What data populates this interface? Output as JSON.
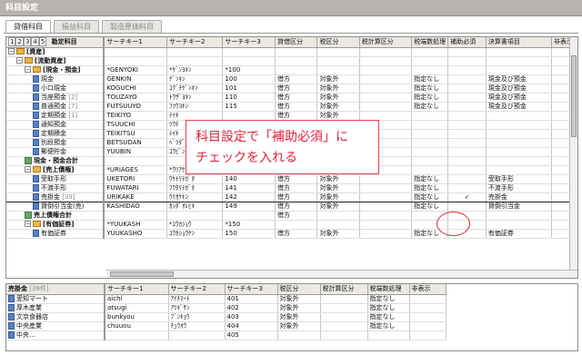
{
  "window": {
    "title": "科目設定"
  },
  "tabs": [
    {
      "label": "貸借科目"
    },
    {
      "label": "損益科目"
    },
    {
      "label": "製造原価科目"
    }
  ],
  "grid": {
    "levels": [
      "1",
      "2",
      "3",
      "4",
      "5"
    ],
    "columns": [
      "勘定科目",
      "サーチキー1",
      "サーチキー2",
      "サーチキー3",
      "貸借区分",
      "税区分",
      "税計算区分",
      "税端数処理",
      "補助必須",
      "決算書項目",
      "非表示"
    ],
    "rows": [
      {
        "name": "[資産]",
        "k1": "",
        "k2": "",
        "k3": "",
        "dr": "",
        "tax": "",
        "calc": "",
        "frac": "",
        "req": "",
        "fin": "",
        "hide": ""
      },
      {
        "name": "[流動資産]",
        "k1": "",
        "k2": "",
        "k3": "",
        "dr": "",
        "tax": "",
        "calc": "",
        "frac": "",
        "req": "",
        "fin": "",
        "hide": ""
      },
      {
        "name": "[現金・預金]",
        "k1": "*GENYOKI",
        "k2": "*ｹﾞﾝﾖｷﾝ",
        "k3": "*100",
        "dr": "",
        "tax": "",
        "calc": "",
        "frac": "",
        "req": "",
        "fin": "",
        "hide": ""
      },
      {
        "name": "現金",
        "k1": "GENKIN",
        "k2": "ｹﾞﾝｷﾝ",
        "k3": "100",
        "dr": "借方",
        "tax": "対象外",
        "calc": "",
        "frac": "指定なし",
        "req": "",
        "fin": "現金及び預金",
        "hide": ""
      },
      {
        "name": "小口現金",
        "k1": "KOGUCHI",
        "k2": "ｺｸﾞﾁｹﾞﾝｷﾝ",
        "k3": "101",
        "dr": "借方",
        "tax": "対象外",
        "calc": "",
        "frac": "指定なし",
        "req": "",
        "fin": "現金及び預金",
        "hide": ""
      },
      {
        "name": "当座預金",
        "count": "[2]",
        "k1": "TOUZAYO",
        "k2": "ﾄｳｻﾞﾖｷﾝ",
        "k3": "110",
        "dr": "借方",
        "tax": "対象外",
        "calc": "",
        "frac": "指定なし",
        "req": "",
        "fin": "現金及び預金",
        "hide": ""
      },
      {
        "name": "普通預金",
        "count": "[7]",
        "k1": "FUTSUUYO",
        "k2": "ﾌﾂｳﾖｷﾝ",
        "k3": "115",
        "dr": "借方",
        "tax": "対象外",
        "calc": "",
        "frac": "指定なし",
        "req": "",
        "fin": "現金及び預金",
        "hide": ""
      },
      {
        "name": "定期預金",
        "count": "[1]",
        "k1": "TEIKIYO",
        "k2": "ﾃｲｷ",
        "k3": "",
        "dr": "借方",
        "tax": "対象外",
        "calc": "",
        "frac": "",
        "req": "",
        "fin": "",
        "hide": ""
      },
      {
        "name": "通知預金",
        "k1": "TSUUCHI",
        "k2": "ﾂｳﾁ",
        "k3": "",
        "dr": "",
        "tax": "",
        "calc": "",
        "frac": "",
        "req": "",
        "fin": "",
        "hide": ""
      },
      {
        "name": "定期積金",
        "k1": "TEIKITSU",
        "k2": "ﾃｲｷ",
        "k3": "",
        "dr": "",
        "tax": "",
        "calc": "",
        "frac": "",
        "req": "",
        "fin": "",
        "hide": ""
      },
      {
        "name": "別段預金",
        "k1": "BETSUDAN",
        "k2": "ﾍﾞﾂﾀﾞﾝ",
        "k3": "",
        "dr": "",
        "tax": "",
        "calc": "",
        "frac": "",
        "req": "",
        "fin": "",
        "hide": ""
      },
      {
        "name": "郵便貯金",
        "k1": "YUUBIN",
        "k2": "ﾕｳﾋﾞﾝ",
        "k3": "",
        "dr": "",
        "tax": "",
        "calc": "",
        "frac": "",
        "req": "",
        "fin": "",
        "hide": ""
      },
      {
        "name": "現金・預金合計",
        "k1": "",
        "k2": "",
        "k3": "",
        "dr": "借方",
        "tax": "",
        "calc": "",
        "frac": "",
        "req": "",
        "fin": "",
        "hide": ""
      },
      {
        "name": "[売上債権]",
        "k1": "*URIAGES",
        "k2": "*ｳﾘｱｹﾞｻｲ",
        "k3": "*140",
        "dr": "",
        "tax": "",
        "calc": "",
        "frac": "",
        "req": "",
        "fin": "",
        "hide": ""
      },
      {
        "name": "受取手形",
        "k1": "UKETORI",
        "k2": "ｳｹﾄﾘﾃｶﾞﾀ",
        "k3": "140",
        "dr": "借方",
        "tax": "対象外",
        "calc": "",
        "frac": "指定なし",
        "req": "",
        "fin": "受取手形",
        "hide": ""
      },
      {
        "name": "不渡手形",
        "k1": "FUWATARI",
        "k2": "ﾌﾜﾀﾘﾃｶﾞﾀ",
        "k3": "141",
        "dr": "借方",
        "tax": "対象外",
        "calc": "",
        "frac": "指定なし",
        "req": "",
        "fin": "不渡手形",
        "hide": ""
      },
      {
        "name": "売掛金",
        "count": "[39]",
        "k1": "URIKAKE",
        "k2": "ｳﾘｶｹｷﾝ",
        "k3": "142",
        "dr": "借方",
        "tax": "対象外",
        "calc": "",
        "frac": "指定なし",
        "req": "✓",
        "fin": "売掛金",
        "hide": ""
      },
      {
        "name": "貸倒引当金(売)",
        "k1": "KASHIDAO",
        "k2": "ｶｼﾀﾞｵﾚﾋｷ",
        "k3": "149",
        "dr": "借方",
        "tax": "対象外",
        "calc": "",
        "frac": "指定なし",
        "req": "",
        "fin": "貸倒引当金",
        "hide": ""
      },
      {
        "name": "売上債権合計",
        "k1": "",
        "k2": "",
        "k3": "",
        "dr": "借方",
        "tax": "",
        "calc": "",
        "frac": "",
        "req": "",
        "fin": "",
        "hide": ""
      },
      {
        "name": "[有価証券]",
        "k1": "*YUUKASH",
        "k2": "*ﾕｳｶｼｮｳ",
        "k3": "*150",
        "dr": "",
        "tax": "",
        "calc": "",
        "frac": "",
        "req": "",
        "fin": "",
        "hide": ""
      },
      {
        "name": "有価証券",
        "k1": "YUUKASHO",
        "k2": "ﾕｳｶｼｮｳｹﾝ",
        "k3": "150",
        "dr": "借方",
        "tax": "対象外",
        "calc": "",
        "frac": "指定なし",
        "req": "",
        "fin": "有価証券",
        "hide": ""
      }
    ]
  },
  "callout": {
    "line1": "科目設定で「補助必須」に",
    "line2": "チェックを入れる"
  },
  "sub_grid": {
    "title": "売掛金",
    "count": "[39件]",
    "columns": [
      "サーチキー1",
      "サーチキー2",
      "サーチキー3",
      "税区分",
      "税計算区分",
      "税端数処理",
      "非表示"
    ],
    "rows": [
      {
        "name": "愛知マート",
        "k1": "aichi",
        "k2": "ｱｲﾁﾏｰﾄ",
        "k3": "401",
        "tax": "対象外",
        "calc": "",
        "frac": "指定なし",
        "hide": ""
      },
      {
        "name": "厚木産業",
        "k1": "atsugi",
        "k2": "ｱﾂｷﾞｻﾝ",
        "k3": "402",
        "tax": "対象外",
        "calc": "",
        "frac": "指定なし",
        "hide": ""
      },
      {
        "name": "文京食器店",
        "k1": "bunkyou",
        "k2": "ﾌﾞﾝｷｮｳ",
        "k3": "403",
        "tax": "対象外",
        "calc": "",
        "frac": "指定なし",
        "hide": ""
      },
      {
        "name": "中央産業",
        "k1": "chuuou",
        "k2": "ﾁｭｳｵｳ",
        "k3": "404",
        "tax": "対象外",
        "calc": "",
        "frac": "指定なし",
        "hide": ""
      },
      {
        "name": "中央…",
        "k1": "",
        "k2": "",
        "k3": "405",
        "tax": "",
        "calc": "",
        "frac": "",
        "hide": ""
      }
    ]
  }
}
